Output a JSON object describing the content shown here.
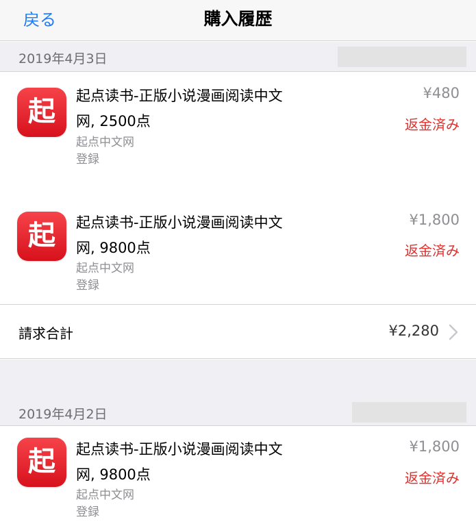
{
  "nav": {
    "back_label": "戻る",
    "title": "購入履歴"
  },
  "sections": [
    {
      "date": "2019年4月3日",
      "items": [
        {
          "title_line1": "起点读书-正版小说漫画阅读中文",
          "title_line2": "网, 2500点",
          "seller": "起点中文网",
          "kind": "登録",
          "price": "¥480",
          "status": "返金済み",
          "icon_glyph": "起",
          "icon": "qidian-app-icon"
        },
        {
          "title_line1": "起点读书-正版小说漫画阅读中文",
          "title_line2": "网, 9800点",
          "seller": "起点中文网",
          "kind": "登録",
          "price": "¥1,800",
          "status": "返金済み",
          "icon_glyph": "起",
          "icon": "qidian-app-icon"
        }
      ],
      "total_label": "請求合計",
      "total_value": "¥2,280"
    },
    {
      "date": "2019年4月2日",
      "items": [
        {
          "title_line1": "起点读书-正版小说漫画阅读中文",
          "title_line2": "网, 9800点",
          "seller": "起点中文网",
          "kind": "登録",
          "price": "¥1,800",
          "status": "返金済み",
          "icon_glyph": "起",
          "icon": "qidian-app-icon"
        }
      ]
    }
  ],
  "colors": {
    "accent": "#1f7cf3",
    "refund": "#e0302d",
    "icon_red": "#e51c25",
    "section_bg": "#efeff4"
  }
}
